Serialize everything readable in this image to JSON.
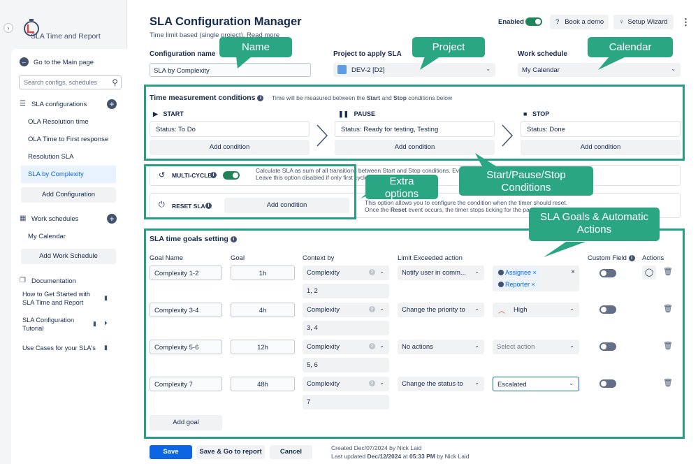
{
  "app": {
    "name": "SLA Time and Report"
  },
  "sidebar": {
    "back": "Go to the Main page",
    "search_placeholder": "Search configs, schedules",
    "sla_section": "SLA configurations",
    "configs": [
      "OLA Resolution time",
      "OLA Time to First response",
      "Resolution SLA",
      "SLA by Complexity"
    ],
    "add_config": "Add Configuration",
    "ws_section": "Work schedules",
    "schedules": [
      "My Calendar"
    ],
    "add_schedule": "Add Work Schedule",
    "doc_section": "Documentation",
    "docs": [
      "How to Get Started with SLA Time and Report",
      "SLA Configuration Tutorial",
      "Use Cases for your SLA's"
    ]
  },
  "header": {
    "title": "SLA Configuration Manager",
    "subtitle": "Time limit based (single project). Read more",
    "enabled_label": "Enabled",
    "demo": "Book a demo",
    "wizard": "Setup Wizard"
  },
  "form": {
    "name_label": "Configuration name",
    "name_value": "SLA by Complexity",
    "project_label": "Project to apply SLA",
    "project_value": "DEV-2 [D2]",
    "ws_label": "Work schedule",
    "ws_value": "My Calendar"
  },
  "tmc": {
    "title": "Time measurement conditions",
    "note_pre": "Time will be measured between the ",
    "note_start": "Start",
    "note_and": " and ",
    "note_stop": "Stop",
    "note_post": " conditions below",
    "start": "START",
    "pause": "PAUSE",
    "stop": "STOP",
    "start_cond": "Status: To Do",
    "pause_cond": "Status: Ready for testing, Testing",
    "stop_cond": "Status: Done",
    "add_condition": "Add condition"
  },
  "multi": {
    "label": "MULTI-CYCLE",
    "desc1": "Calculate SLA as sum of all transitions between Start and Stop conditions. Every ne",
    "desc2": "Leave this option disabled if only first cycle is"
  },
  "reset": {
    "label": "RESET SLA",
    "add": "Add condition",
    "desc1": "This option allows you to configure the condition when the timer should reset.",
    "desc2_pre": "Once the ",
    "desc2_bold": "Reset",
    "desc2_post": " event occurs, the timer stops ticking for the particu"
  },
  "goals": {
    "title": "SLA time goals setting",
    "headers": [
      "Goal Name",
      "Goal",
      "Context by",
      "Limit Exceeded action",
      "Custom Field",
      "Actions"
    ],
    "rows": [
      {
        "name": "Complexity 1-2",
        "goal": "1h",
        "context": "Complexity",
        "values": "1, 2",
        "action": "Notify user in comm...",
        "tags": [
          "Assignee",
          "Reporter"
        ]
      },
      {
        "name": "Complexity 3-4",
        "goal": "4h",
        "context": "Complexity",
        "values": "3, 4",
        "action": "Change the priority to",
        "priority": "High"
      },
      {
        "name": "Complexity 5-6",
        "goal": "12h",
        "context": "Complexity",
        "values": "5, 6",
        "action": "No actions",
        "placeholder": "Select action"
      },
      {
        "name": "Complexity 7",
        "goal": "48h",
        "context": "Complexity",
        "values": "7",
        "action": "Change the status to",
        "status": "Escalated"
      }
    ],
    "add_goal": "Add goal"
  },
  "footer": {
    "save": "Save",
    "save_report": "Save & Go to report",
    "cancel": "Cancel",
    "created": "Created Dec/07/2024 by Nick Laid",
    "updated_pre": "Last updated ",
    "updated_date": "Dec/12/2024",
    "updated_at": " at ",
    "updated_time": "05:33 PM",
    "updated_post": " by Nick Laid"
  },
  "callouts": {
    "name": "Name",
    "project": "Project",
    "calendar": "Calendar",
    "conditions": "Start/Pause/Stop Conditions",
    "extra": "Extra options",
    "goals": "SLA Goals & Automatic Actions"
  },
  "colors": {
    "accent": "#0c66e4",
    "highlight": "#2aa683",
    "toggle_on": "#1f845a"
  }
}
